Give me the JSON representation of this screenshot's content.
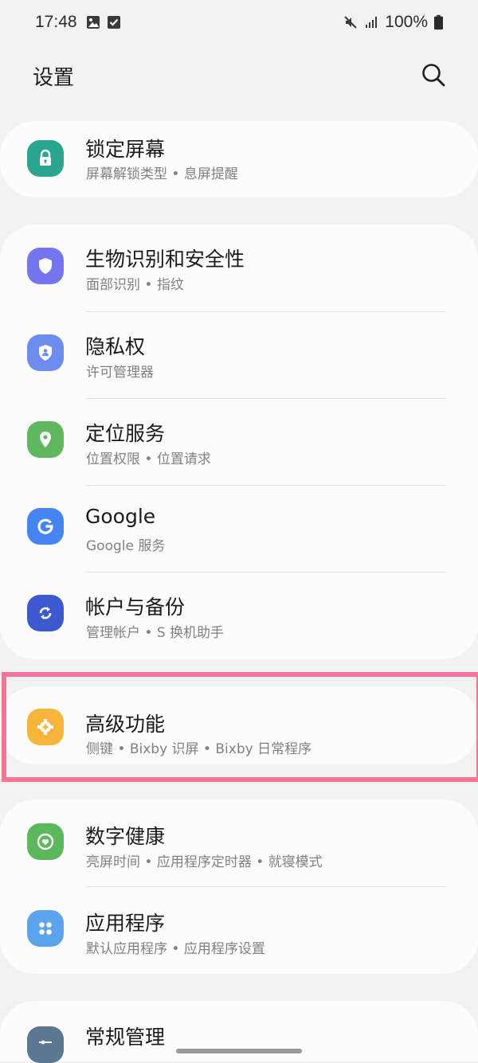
{
  "status_bar": {
    "time": "17:48",
    "battery_text": "100%"
  },
  "header": {
    "title": "设置"
  },
  "cards": [
    {
      "items": [
        {
          "title": "锁定屏幕",
          "subtitle": "屏幕解锁类型 • 息屏提醒",
          "icon": "lock-icon",
          "color": "#2aa58e"
        }
      ]
    },
    {
      "items": [
        {
          "title": "生物识别和安全性",
          "subtitle": "面部识别 • 指纹",
          "icon": "shield-icon",
          "color": "#7376ee"
        },
        {
          "title": "隐私权",
          "subtitle": "许可管理器",
          "icon": "privacy-shield-icon",
          "color": "#6d8cf0"
        },
        {
          "title": "定位服务",
          "subtitle": "位置权限 • 位置请求",
          "icon": "location-pin-icon",
          "color": "#5fb85e"
        },
        {
          "title": "Google",
          "subtitle": "Google 服务",
          "icon": "google-icon",
          "color": "#4585f2"
        },
        {
          "title": "帐户与备份",
          "subtitle": "管理帐户 • S 换机助手",
          "icon": "sync-icon",
          "color": "#3d59cf"
        }
      ]
    },
    {
      "items": [
        {
          "title": "高级功能",
          "subtitle": "侧键 • Bixby 识屏 • Bixby 日常程序",
          "icon": "gear-plus-icon",
          "color": "#f6b43a"
        }
      ]
    },
    {
      "items": [
        {
          "title": "数字健康",
          "subtitle": "亮屏时间 • 应用程序定时器 • 就寝模式",
          "icon": "heart-ring-icon",
          "color": "#5cb85c"
        },
        {
          "title": "应用程序",
          "subtitle": "默认应用程序 • 应用程序设置",
          "icon": "apps-grid-icon",
          "color": "#5ba3ec"
        }
      ]
    },
    {
      "items": [
        {
          "title": "常规管理",
          "subtitle": "",
          "icon": "sliders-icon",
          "color": "#5c7891"
        }
      ]
    }
  ],
  "colors": {
    "highlight": "#f57597",
    "background": "#f2f2f2",
    "card": "#fcfcfc"
  }
}
